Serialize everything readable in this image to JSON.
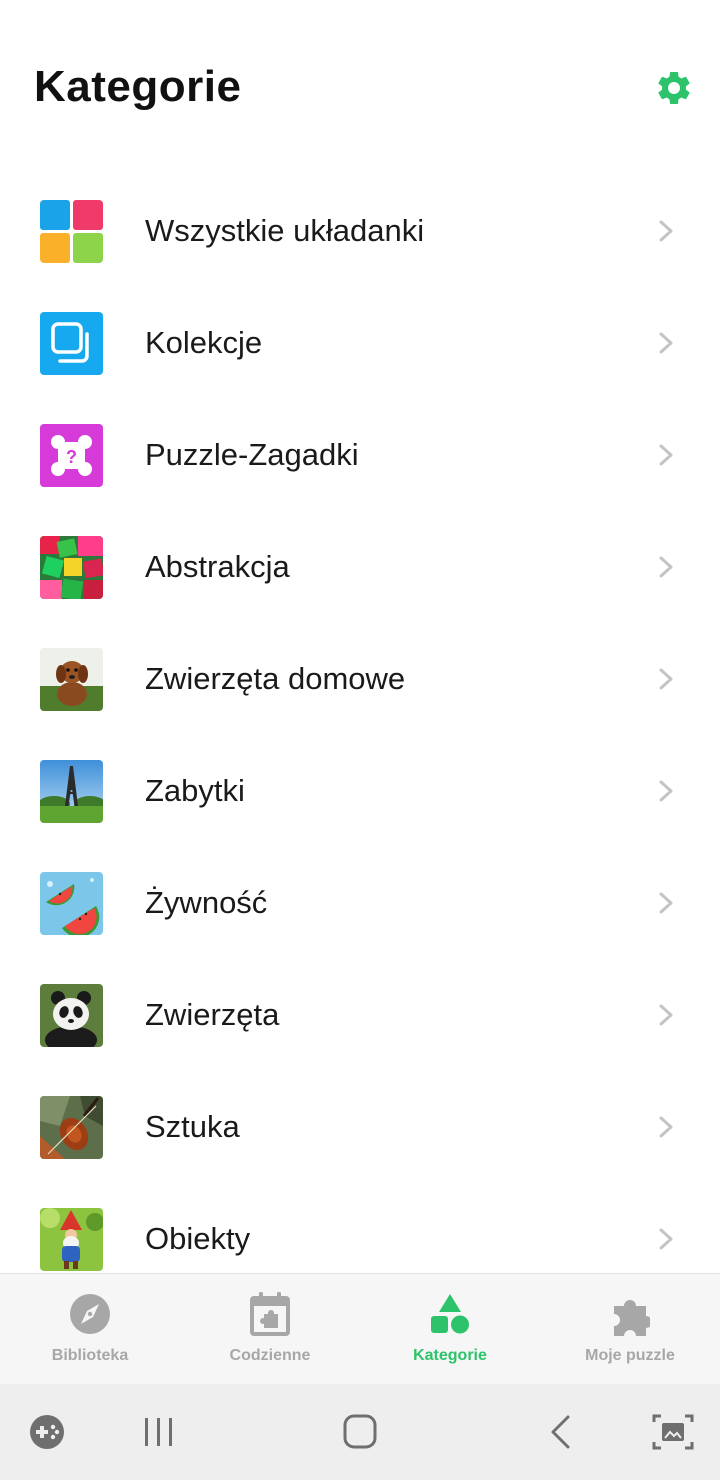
{
  "header": {
    "title": "Kategorie",
    "settings_icon": "gear-icon",
    "accent_color": "#2dc36a"
  },
  "categories": [
    {
      "label": "Wszystkie układanki",
      "icon": "all-puzzles-grid-icon"
    },
    {
      "label": "Kolekcje",
      "icon": "collections-icon"
    },
    {
      "label": "Puzzle-Zagadki",
      "icon": "mystery-puzzle-icon"
    },
    {
      "label": "Abstrakcja",
      "icon": "abstract-thumbnail"
    },
    {
      "label": "Zwierzęta domowe",
      "icon": "pet-dog-thumbnail"
    },
    {
      "label": "Zabytki",
      "icon": "eiffel-tower-thumbnail"
    },
    {
      "label": "Żywność",
      "icon": "watermelon-thumbnail"
    },
    {
      "label": "Zwierzęta",
      "icon": "panda-thumbnail"
    },
    {
      "label": "Sztuka",
      "icon": "violin-art-thumbnail"
    },
    {
      "label": "Obiekty",
      "icon": "garden-gnome-thumbnail"
    }
  ],
  "tabs": [
    {
      "label": "Biblioteka",
      "icon": "compass-icon",
      "active": false
    },
    {
      "label": "Codzienne",
      "icon": "calendar-puzzle-icon",
      "active": false
    },
    {
      "label": "Kategorie",
      "icon": "shapes-icon",
      "active": true
    },
    {
      "label": "Moje puzzle",
      "icon": "puzzle-piece-icon",
      "active": false
    }
  ],
  "system_nav": {
    "buttons": [
      "game-launcher-icon",
      "recent-apps-icon",
      "home-icon",
      "back-icon",
      "screenshot-icon"
    ]
  }
}
